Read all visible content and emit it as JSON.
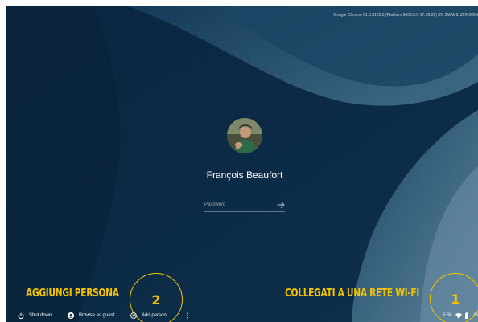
{
  "screen": {
    "version_info": "Google Chrome 61.0.3125.0 (Platform 9633.0.0-17.06.09) SN:5MAD91ZHN000S"
  },
  "login": {
    "user_name": "François Beaufort",
    "password_placeholder": "Password",
    "avatar_icon": "user-photo",
    "submit_icon": "arrow-right-icon"
  },
  "annotations": {
    "add_person_caption": "AGGIUNGI PERSONA",
    "add_person_number": "2",
    "wifi_caption": "COLLEGATI A UNA RETE WI-FI",
    "wifi_number": "1",
    "color": "#f2c200"
  },
  "shelf": {
    "shutdown_label": "Shut down",
    "guest_label": "Browse as guest",
    "add_person_label": "Add person",
    "menu_icon": "more-vertical-icon"
  },
  "tray": {
    "time": "6:58",
    "wifi_icon": "wifi-icon",
    "battery_icon": "battery-icon",
    "locale": "US"
  },
  "colors": {
    "wallpaper_dark": "#0c2a45",
    "wallpaper_light": "#4f7791"
  }
}
